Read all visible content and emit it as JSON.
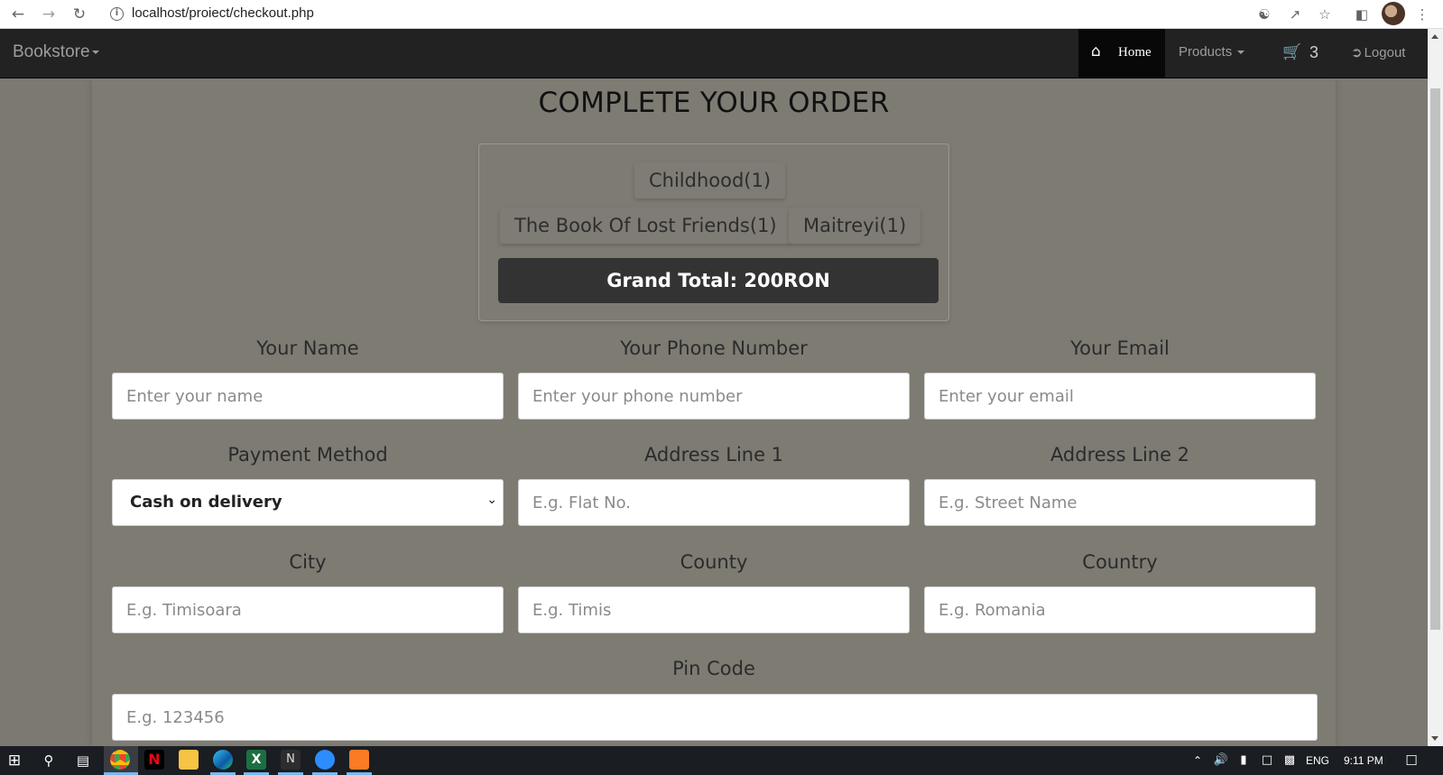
{
  "browser": {
    "url": "localhost/proiect/checkout.php",
    "back_icon": "back-arrow-icon",
    "forward_icon": "forward-arrow-icon",
    "reload_icon": "reload-icon"
  },
  "navbar": {
    "brand": "Bookstore",
    "home": "Home",
    "products": "Products",
    "cart_count": "3",
    "logout": "Logout",
    "accent_color": "#1ec0a0"
  },
  "checkout": {
    "title": "COMPLETE YOUR ORDER",
    "items": [
      "Childhood(1)",
      "The Book Of Lost Friends(1)",
      "Maitreyi(1)"
    ],
    "grand_total": "Grand Total: 200RON"
  },
  "form": {
    "name": {
      "label": "Your Name",
      "placeholder": "Enter your name"
    },
    "phone": {
      "label": "Your Phone Number",
      "placeholder": "Enter your phone number"
    },
    "email": {
      "label": "Your Email",
      "placeholder": "Enter your email"
    },
    "payment": {
      "label": "Payment Method",
      "selected": "Cash on delivery"
    },
    "address1": {
      "label": "Address Line 1",
      "placeholder": "E.g. Flat No."
    },
    "address2": {
      "label": "Address Line 2",
      "placeholder": "E.g. Street Name"
    },
    "city": {
      "label": "City",
      "placeholder": "E.g. Timisoara"
    },
    "county": {
      "label": "County",
      "placeholder": "E.g. Timis"
    },
    "country": {
      "label": "Country",
      "placeholder": "E.g. Romania"
    },
    "pin": {
      "label": "Pin Code",
      "placeholder": "E.g. 123456"
    }
  },
  "taskbar": {
    "language": "ENG",
    "time": "9:11 PM"
  }
}
